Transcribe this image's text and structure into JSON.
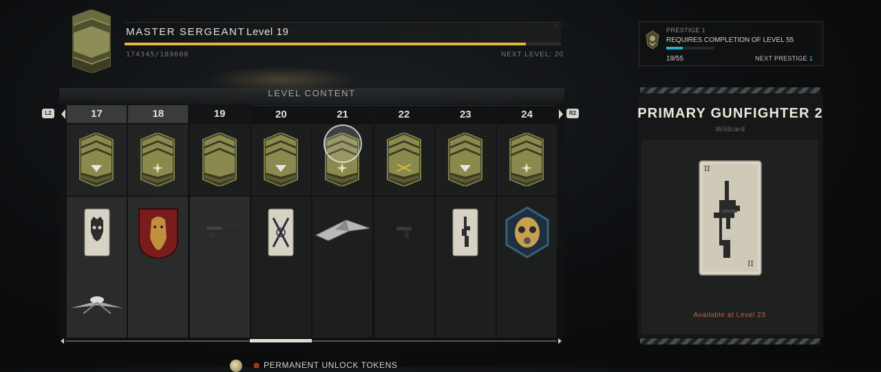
{
  "header": {
    "rank_title": "MASTER SERGEANT",
    "level_label": "Level 19",
    "xp_text": "174345/189600",
    "xp_progress": 0.92,
    "next_level_text": "NEXT LEVEL: 20",
    "menu_dots": "· · ·"
  },
  "prestige": {
    "name": "PRESTIGE 1",
    "requirement": "REQUIRES COMPLETION OF LEVEL 55",
    "progress_text": "19/55",
    "progress": 0.345,
    "next_prestige_label": "NEXT PRESTIGE",
    "next_prestige_value": "1",
    "accent_color": "#1fb5cc"
  },
  "level_content": {
    "title": "LEVEL CONTENT",
    "left_button": "L2",
    "right_button": "R2",
    "columns": [
      {
        "level": "17",
        "state": "past",
        "insignia": "arrow-down",
        "rewards": [
          "skull-calling-card",
          "attack-drone"
        ]
      },
      {
        "level": "18",
        "state": "past",
        "insignia": "star",
        "rewards": [
          "lion-emblem"
        ]
      },
      {
        "level": "19",
        "state": "current",
        "insignia": "none",
        "rewards": [
          "rifle-weapon"
        ]
      },
      {
        "level": "20",
        "state": "future",
        "insignia": "arrow-down",
        "rewards": [
          "crossed-blades-calling-card"
        ]
      },
      {
        "level": "21",
        "state": "future",
        "insignia": "star",
        "rewards": [
          "stealth-jet"
        ]
      },
      {
        "level": "22",
        "state": "future",
        "insignia": "crossed-rifles",
        "rewards": [
          "pistol-weapon"
        ]
      },
      {
        "level": "23",
        "state": "future",
        "insignia": "arrow-down",
        "rewards": [
          "gunfighter-card"
        ]
      },
      {
        "level": "24",
        "state": "future",
        "insignia": "star",
        "rewards": [
          "gas-mask-emblem"
        ]
      }
    ]
  },
  "side_card": {
    "title": "PRIMARY GUNFIGHTER 2",
    "subtitle": "Wildcard",
    "card_corner": "II",
    "availability": "Available at Level 23"
  },
  "footer": {
    "alert_mark": "⊗",
    "tokens_label": "PERMANENT UNLOCK TOKENS"
  },
  "colors": {
    "xp_bar": "#e8b73a",
    "insignia_olive": "#8a8a4e",
    "availability_text": "#c9632c"
  }
}
